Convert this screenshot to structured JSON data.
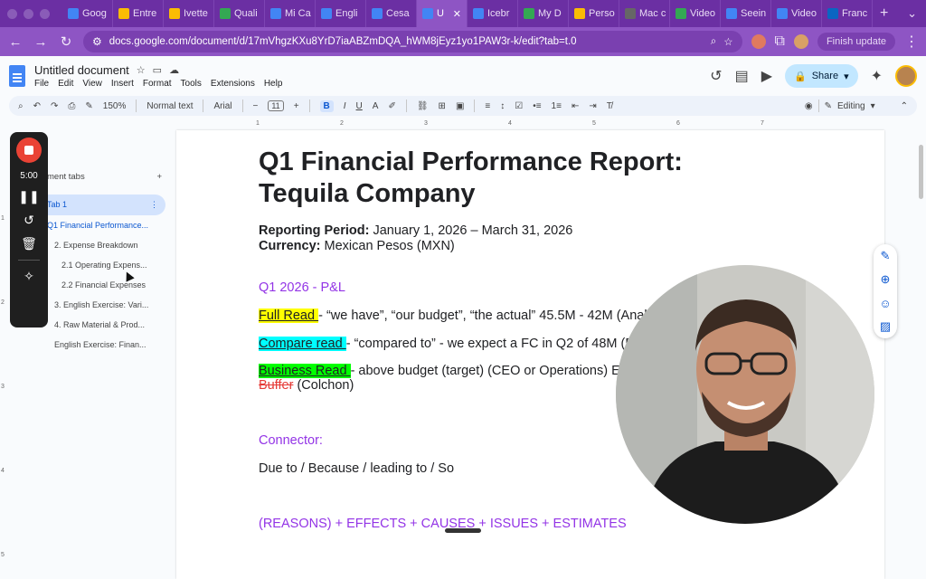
{
  "browser": {
    "tabs": [
      {
        "label": "Goog",
        "color": "#4285f4"
      },
      {
        "label": "Entre",
        "color": "#fbbc04"
      },
      {
        "label": "Ivette",
        "color": "#fbbc04"
      },
      {
        "label": "Quali",
        "color": "#34a853"
      },
      {
        "label": "Mi Ca",
        "color": "#4285f4"
      },
      {
        "label": "Engli",
        "color": "#4285f4"
      },
      {
        "label": "Cesa",
        "color": "#4285f4"
      },
      {
        "label": "U",
        "color": "#4285f4",
        "active": true
      },
      {
        "label": "Icebr",
        "color": "#4285f4"
      },
      {
        "label": "My D",
        "color": "#34a853"
      },
      {
        "label": "Perso",
        "color": "#fbbc04"
      },
      {
        "label": "Mac c",
        "color": "#666666"
      },
      {
        "label": "Video",
        "color": "#34a853"
      },
      {
        "label": "Seein",
        "color": "#4285f4"
      },
      {
        "label": "Video",
        "color": "#4285f4"
      },
      {
        "label": "Franc",
        "color": "#0a66c2"
      }
    ],
    "url": "docs.google.com/document/d/17mVhgzKXu8YrD7iaABZmDQA_hWM8jEyz1yo1PAW3r-k/edit?tab=t.0",
    "finish_update": "Finish update"
  },
  "doc": {
    "title": "Untitled document",
    "menus": [
      "File",
      "Edit",
      "View",
      "Insert",
      "Format",
      "Tools",
      "Extensions",
      "Help"
    ],
    "share_label": "Share"
  },
  "toolbar": {
    "zoom": "150%",
    "style": "Normal text",
    "font": "Arial",
    "font_size": "11",
    "mode": "Editing"
  },
  "ruler": {
    "marks": [
      "1",
      "2",
      "3",
      "4",
      "5",
      "6",
      "7"
    ],
    "left_marks": [
      "1",
      "2",
      "3",
      "4",
      "5"
    ]
  },
  "outline": {
    "header": "Document tabs",
    "header_visible": "ment tabs",
    "tab_label": "Tab 1",
    "items": [
      {
        "label": "Q1 Financial Performance...",
        "level": 1
      },
      {
        "label": "2. Expense Breakdown",
        "level": 2
      },
      {
        "label": "2.1 Operating Expens...",
        "level": 3
      },
      {
        "label": "2.2 Financial Expenses",
        "level": 3
      },
      {
        "label": "3. English Exercise: Vari...",
        "level": 2
      },
      {
        "label": "4. Raw Material & Prod...",
        "level": 2
      },
      {
        "label": "English Exercise: Finan...",
        "level": 2
      }
    ]
  },
  "recorder": {
    "time": "5:00"
  },
  "content": {
    "title_line1": "Q1 Financial Performance Report:",
    "title_line2": "Tequila Company",
    "period_label": "Reporting Period:",
    "period_value": " January 1, 2026 – March 31, 2026",
    "currency_label": "Currency:",
    "currency_value": " Mexican Pesos (MXN)",
    "section_pl": "Q1 2026 - P&L",
    "full_read_hl": "Full Read ",
    "full_read_text": "- “we have”, “our budget”, “the actual” 45.5M - 42M (Analyt",
    "compare_hl": "Compare read ",
    "compare_text": "- “compared to” - we expect a FC in Q2 of 48M  (Fi",
    "business_hl": "Business Read ",
    "business_text": "- above budget (target)  (CEO or Operations) Ex",
    "buffer_strike": "Buffer",
    "buffer_text": " (Colchon)",
    "connector": "Connector:",
    "connector_text": "Due to / Because / leading to / So",
    "reasons": "(REASONS) + EFFECTS + CAUSES + ISSUES + ESTIMATES"
  }
}
